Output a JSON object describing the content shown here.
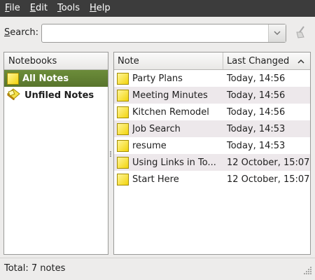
{
  "menu": [
    "File",
    "Edit",
    "Tools",
    "Help"
  ],
  "menu_mnemonics": [
    "F",
    "E",
    "T",
    "H"
  ],
  "search": {
    "label": "Search:",
    "mnemonic": "S",
    "value": "",
    "placeholder": ""
  },
  "notebooks": {
    "header": "Notebooks",
    "items": [
      {
        "label": "All Notes",
        "selected": true,
        "icon": "all-notes-icon"
      },
      {
        "label": "Unfiled Notes",
        "selected": false,
        "icon": "unfiled-notes-icon"
      }
    ]
  },
  "notes": {
    "columns": [
      "Note",
      "Last Changed"
    ],
    "sort": "ascending",
    "rows": [
      {
        "title": "Party Plans",
        "changed": "Today, 14:56"
      },
      {
        "title": "Meeting Minutes",
        "changed": "Today, 14:56"
      },
      {
        "title": "Kitchen Remodel",
        "changed": "Today, 14:56"
      },
      {
        "title": "Job Search",
        "changed": "Today, 14:53"
      },
      {
        "title": "resume",
        "changed": "Today, 14:53"
      },
      {
        "title": "Using Links in To...",
        "changed": "12 October, 15:07"
      },
      {
        "title": "Start Here",
        "changed": "12 October, 15:07"
      }
    ]
  },
  "status": "Total: 7 notes",
  "colors": {
    "menubar": "#3c3c3c",
    "selected": "#58752c",
    "alt_row": "#ede8eb",
    "note_icon": "#f2d40c"
  }
}
